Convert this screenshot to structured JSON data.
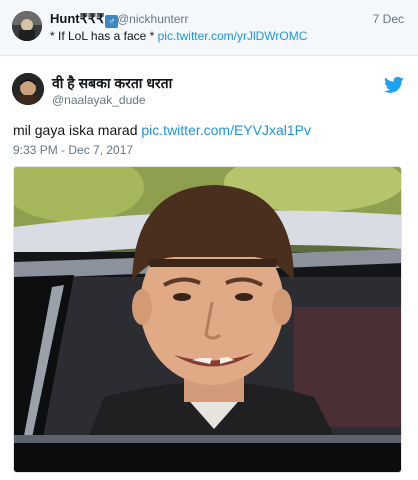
{
  "reply": {
    "name": "Hunt₹₹₹",
    "gender_icon": "♂",
    "handle": "@nickhunterr",
    "date": "7 Dec",
    "text": "* If LoL has a face * ",
    "link": "pic.twitter.com/yrJlDWrOMC"
  },
  "tweet": {
    "name": "वी है सबका करता धरता",
    "handle": "@naalayak_dude",
    "text": "mil gaya iska marad ",
    "link": "pic.twitter.com/EYVJxal1Pv",
    "timestamp": "9:33 PM - Dec 7, 2017"
  },
  "icons": {
    "brand": "twitter-bird-icon",
    "brand_color": "#1da1f2",
    "link_color": "#1b95e0"
  }
}
